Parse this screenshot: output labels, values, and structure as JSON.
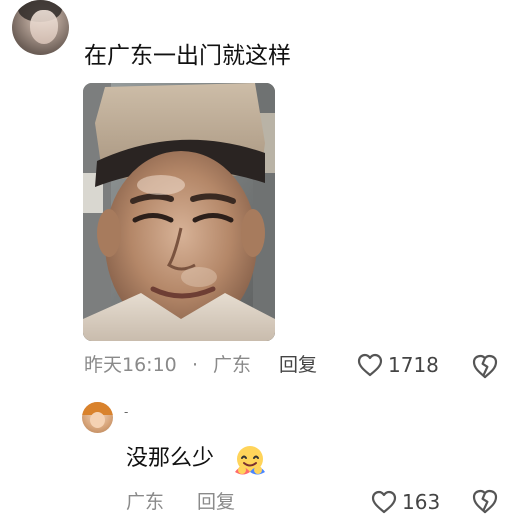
{
  "comment": {
    "text": "在广东一出门就这样",
    "time": "昨天16:10",
    "separator": "·",
    "location": "广东",
    "reply_label": "回复",
    "likes": "1718"
  },
  "reply": {
    "name": "-",
    "text": "没那么少",
    "emoji": "hugging-face-emoji",
    "location": "广东",
    "reply_label": "回复",
    "likes": "163"
  },
  "icons": {
    "like": "heart-outline-icon",
    "dislike": "broken-heart-icon"
  },
  "colors": {
    "text": "#111111",
    "meta": "#8a8a8a",
    "action": "#444444"
  }
}
